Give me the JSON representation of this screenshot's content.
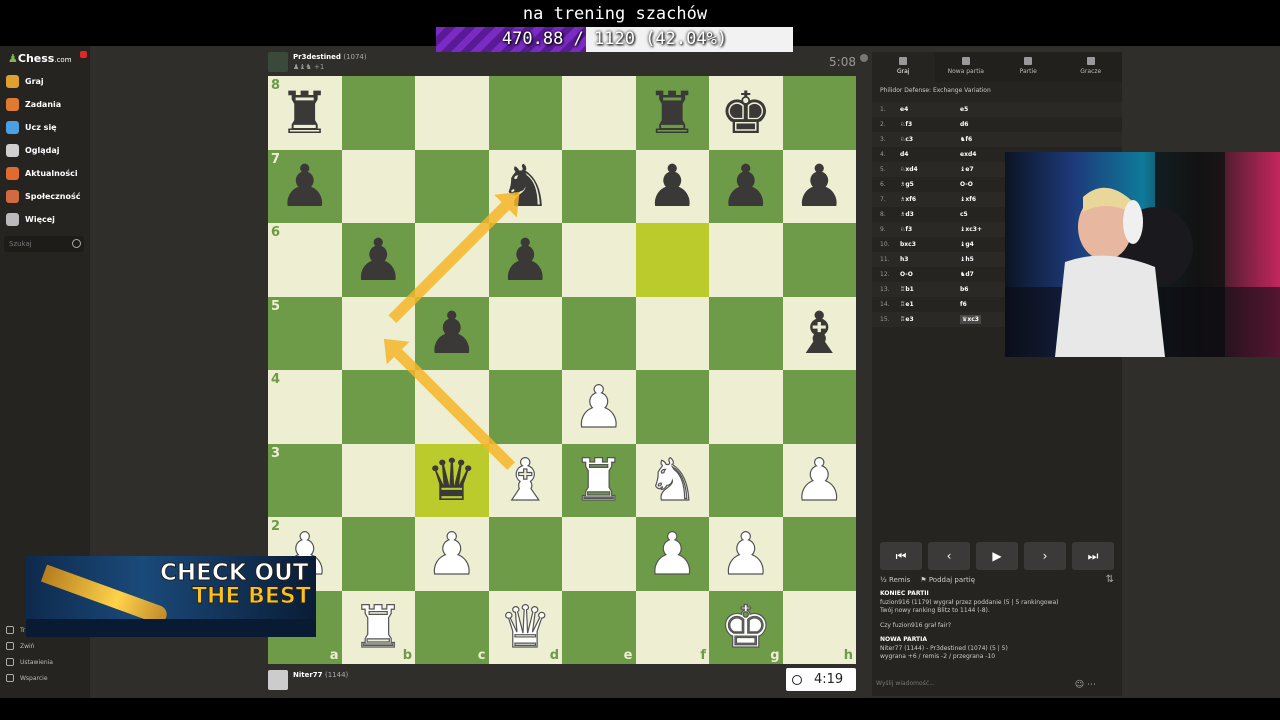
{
  "stream": {
    "title": "na trening szachów",
    "progress_text": "470.88 / 1120 (42.04%)",
    "progress_value": 0.4204
  },
  "sidebar": {
    "logo": "Chess",
    "logo_suffix": ".com",
    "items": [
      {
        "label": "Graj",
        "icon": "play-pawn-icon",
        "color": "#e0a030"
      },
      {
        "label": "Zadania",
        "icon": "puzzle-icon",
        "color": "#e07a30"
      },
      {
        "label": "Ucz się",
        "icon": "learn-icon",
        "color": "#4aa0e0"
      },
      {
        "label": "Oglądaj",
        "icon": "watch-icon",
        "color": "#d0d0d0"
      },
      {
        "label": "Aktualności",
        "icon": "news-icon",
        "color": "#e06a30"
      },
      {
        "label": "Społeczność",
        "icon": "community-icon",
        "color": "#d06a40"
      },
      {
        "label": "Więcej",
        "icon": "more-icon",
        "color": "#bbbbbb"
      }
    ],
    "search_placeholder": "Szukaj",
    "bottom": [
      {
        "label": "Tr"
      },
      {
        "label": "Zwiń"
      },
      {
        "label": "Ustawienia"
      },
      {
        "label": "Wsparcie"
      }
    ]
  },
  "top_player": {
    "name": "Pr3destined",
    "rating": "(1074)",
    "captures": "♟♝♞ +1",
    "clock": "5:08"
  },
  "bottom_player": {
    "name": "Niter77",
    "rating": "(1144)",
    "clock": "4:19"
  },
  "board": {
    "ranks": [
      "8",
      "7",
      "6",
      "5",
      "4",
      "3",
      "2",
      "1"
    ],
    "files": [
      "a",
      "b",
      "c",
      "d",
      "e",
      "f",
      "g",
      "h"
    ],
    "highlighted": [
      "f6",
      "c3"
    ],
    "position": {
      "a8": "bR",
      "f8": "bR",
      "g8": "bK",
      "a7": "bP",
      "d7": "bN",
      "f7": "bP",
      "g7": "bP",
      "h7": "bP",
      "b6": "bP",
      "d6": "bP",
      "c5": "bP",
      "h5": "bB",
      "e4": "wP",
      "c3": "bQ",
      "d3": "wB",
      "e3": "wR",
      "f3": "wN",
      "h3": "wP",
      "a2": "wP",
      "c2": "wP",
      "f2": "wP",
      "g2": "wP",
      "b1": "wR",
      "d1": "wQ",
      "g1": "wK"
    },
    "arrow_color": "#f5b52a"
  },
  "panel": {
    "tabs": [
      "Graj",
      "Nowa partia",
      "Partie",
      "Gracze"
    ],
    "opening": "Philidor Defense: Exchange Variation",
    "moves": [
      {
        "n": "1.",
        "w": "e4",
        "b": "e5"
      },
      {
        "n": "2.",
        "w": "♘f3",
        "b": "d6"
      },
      {
        "n": "3.",
        "w": "♘c3",
        "b": "♞f6"
      },
      {
        "n": "4.",
        "w": "d4",
        "b": "exd4"
      },
      {
        "n": "5.",
        "w": "♘xd4",
        "b": "♝e7"
      },
      {
        "n": "6.",
        "w": "♗g5",
        "b": "O-O"
      },
      {
        "n": "7.",
        "w": "♗xf6",
        "b": "♝xf6"
      },
      {
        "n": "8.",
        "w": "♗d3",
        "b": "c5"
      },
      {
        "n": "9.",
        "w": "♘f3",
        "b": "♝xc3+"
      },
      {
        "n": "10.",
        "w": "bxc3",
        "b": "♝g4"
      },
      {
        "n": "11.",
        "w": "h3",
        "b": "♝h5"
      },
      {
        "n": "12.",
        "w": "O-O",
        "b": "♞d7"
      },
      {
        "n": "13.",
        "w": "♖b1",
        "b": "b6"
      },
      {
        "n": "14.",
        "w": "♖e1",
        "b": "f6"
      },
      {
        "n": "15.",
        "w": "♖e3",
        "b": "♛xc3"
      }
    ],
    "nav": [
      "⏮",
      "‹",
      "▶",
      "›",
      "⏭"
    ],
    "actions": {
      "draw": "Remis",
      "resign": "Poddaj partię"
    },
    "chat": [
      {
        "text": "KONIEC PARTII",
        "bold": true
      },
      {
        "text": "fuzion916 (1179) wygrał przez poddanie (5 | 5 rankingowa)",
        "bold": false
      },
      {
        "text": "Twój nowy ranking Blitz to 1144 (-8).",
        "bold": false
      },
      {
        "text": "Czy fuzion916 grał fair?",
        "bold": false
      },
      {
        "text": "NOWA PARTIA",
        "bold": true
      },
      {
        "text": "Niter77 (1144) - Pr3destined (1074) (5 | 5)",
        "bold": false
      },
      {
        "text": "wygrana +6 / remis -2 / przegrana -10",
        "bold": false
      }
    ],
    "chat_placeholder": "Wyślij wiadomość..."
  },
  "ad": {
    "line1": "CHECK OUT",
    "line2": "THE BEST"
  }
}
